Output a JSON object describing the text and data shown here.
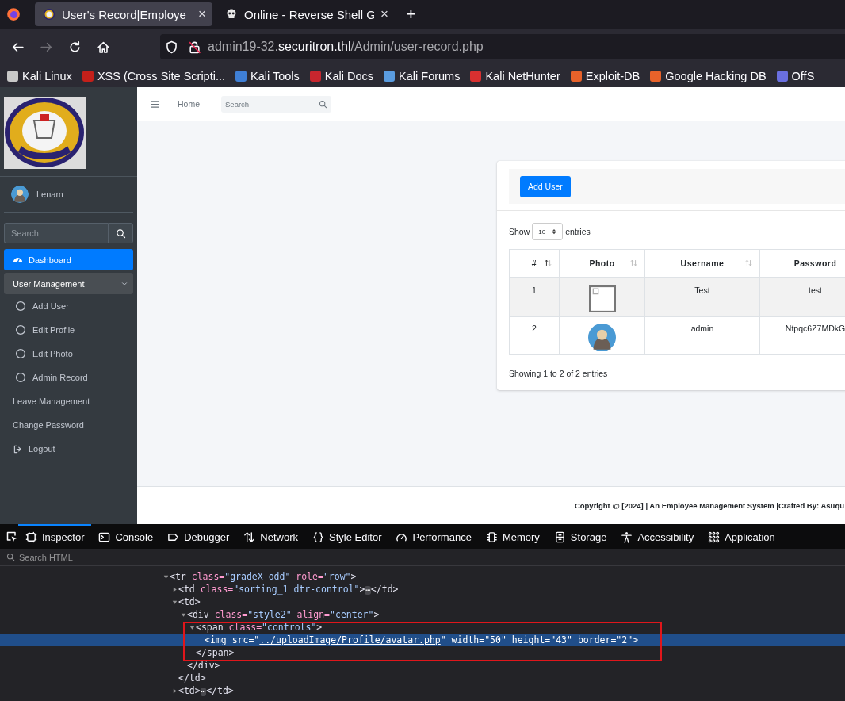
{
  "browser": {
    "tabs": [
      {
        "title": "User's Record|Employe",
        "kind": "emblem",
        "close": "×",
        "selected": true
      },
      {
        "title": "Online - Reverse Shell G",
        "kind": "skull",
        "close": "×",
        "selected": false
      }
    ],
    "new_tab": "+",
    "nav_buttons": [
      {
        "kind": "back",
        "disabled": false
      },
      {
        "kind": "forward",
        "disabled": true
      },
      {
        "kind": "reload",
        "disabled": false
      },
      {
        "kind": "home",
        "disabled": false
      }
    ],
    "address": {
      "host_prefix": "admin19-32.",
      "domain": "securitron.thl",
      "path": "/Admin/user-record.php"
    },
    "bookmarks": [
      {
        "label": "Kali Linux",
        "color": "#c8c8c8"
      },
      {
        "label": "XSS (Cross Site Scripti...",
        "color": "#c4201a"
      },
      {
        "label": "Kali Tools",
        "color": "#3f7fd6"
      },
      {
        "label": "Kali Docs",
        "color": "#c8262e"
      },
      {
        "label": "Kali Forums",
        "color": "#5a9ce0"
      },
      {
        "label": "Kali NetHunter",
        "color": "#d93030"
      },
      {
        "label": "Exploit-DB",
        "color": "#e8622a"
      },
      {
        "label": "Google Hacking DB",
        "color": "#e8622a"
      },
      {
        "label": "OffS",
        "color": "#6a6fe0"
      }
    ]
  },
  "sidebar": {
    "user": {
      "name": "Lenam"
    },
    "search": {
      "placeholder": "Search"
    },
    "menu": [
      {
        "label": "Dashboard",
        "kind": "gauge",
        "selected": true
      },
      {
        "label": "User Management",
        "kind": "group",
        "selected": false,
        "expanded": true,
        "children": [
          {
            "label": "Add User",
            "kind": "circle",
            "selected": false
          },
          {
            "label": "Edit Profile",
            "kind": "circle",
            "selected": false
          },
          {
            "label": "Edit Photo",
            "kind": "circle",
            "selected": false
          },
          {
            "label": "Admin Record",
            "kind": "circle",
            "selected": false
          }
        ]
      },
      {
        "label": "Leave Management",
        "kind": "plain",
        "selected": false
      },
      {
        "label": "Change Password",
        "kind": "plain",
        "selected": false
      },
      {
        "label": "Logout",
        "kind": "signout",
        "selected": false
      }
    ]
  },
  "top_nav": {
    "home_link": "Home",
    "search": {
      "placeholder": "Search"
    }
  },
  "card": {
    "add_button": "Add User",
    "length": {
      "before": "Show",
      "value": "10",
      "after": "entries"
    },
    "table": {
      "columns": [
        {
          "label": "#",
          "kind": "ascending"
        },
        {
          "label": "Photo",
          "kind": "sortable"
        },
        {
          "label": "Username",
          "kind": "sortable"
        },
        {
          "label": "Password",
          "kind": "plain"
        }
      ],
      "rows": [
        {
          "number": "1",
          "kind": "broken",
          "username": "Test",
          "password": "test"
        },
        {
          "number": "2",
          "kind": "avatar",
          "username": "admin",
          "password": "Ntpqc6Z7MDkG"
        }
      ]
    },
    "info": "Showing 1 to 2 of 2 entries"
  },
  "footer": {
    "text": "Copyright @ [2024] | An Employee Management System |Crafted By: Asuqu"
  },
  "devtools": {
    "tools": [
      {
        "label": "Inspector",
        "kind": "inspector",
        "selected": true
      },
      {
        "label": "Console",
        "kind": "console",
        "selected": false
      },
      {
        "label": "Debugger",
        "kind": "debugger",
        "selected": false
      },
      {
        "label": "Network",
        "kind": "network",
        "selected": false
      },
      {
        "label": "Style Editor",
        "kind": "style",
        "selected": false
      },
      {
        "label": "Performance",
        "kind": "performance",
        "selected": false
      },
      {
        "label": "Memory",
        "kind": "memory",
        "selected": false
      },
      {
        "label": "Storage",
        "kind": "storage",
        "selected": false
      },
      {
        "label": "Accessibility",
        "kind": "accessibility",
        "selected": false
      },
      {
        "label": "Application",
        "kind": "application",
        "selected": false
      }
    ],
    "search": {
      "placeholder": "Search HTML"
    },
    "tree": [
      {
        "expanded": true,
        "selected": false,
        "tokens": [
          {
            "kind": "tag",
            "text": "<tr"
          },
          {
            "kind": "attr",
            "text": " class="
          },
          {
            "kind": "value",
            "text": "\"gradeX odd\""
          },
          {
            "kind": "attr",
            "text": " role="
          },
          {
            "kind": "value",
            "text": "\"row\""
          },
          {
            "kind": "tag",
            "text": ">"
          }
        ],
        "children": [
          {
            "expanded": false,
            "selected": false,
            "tokens": [
              {
                "kind": "tag",
                "text": "<td"
              },
              {
                "kind": "attr",
                "text": " class="
              },
              {
                "kind": "value",
                "text": "\"sorting_1 dtr-control\""
              },
              {
                "kind": "tag",
                "text": ">"
              },
              {
                "kind": "badge",
                "text": "⋯"
              },
              {
                "kind": "tag",
                "text": "</td>"
              }
            ]
          },
          {
            "expanded": true,
            "selected": false,
            "tokens": [
              {
                "kind": "tag",
                "text": "<td>"
              }
            ],
            "close": "</td>",
            "children": [
              {
                "expanded": true,
                "selected": false,
                "tokens": [
                  {
                    "kind": "tag",
                    "text": "<div"
                  },
                  {
                    "kind": "attr",
                    "text": " class="
                  },
                  {
                    "kind": "value",
                    "text": "\"style2\""
                  },
                  {
                    "kind": "attr",
                    "text": " align="
                  },
                  {
                    "kind": "value",
                    "text": "\"center\""
                  },
                  {
                    "kind": "tag",
                    "text": ">"
                  }
                ],
                "close": "</div>",
                "children": [
                  {
                    "expanded": true,
                    "selected": false,
                    "boxed": true,
                    "tokens": [
                      {
                        "kind": "tag",
                        "text": "<span"
                      },
                      {
                        "kind": "attr",
                        "text": " class="
                      },
                      {
                        "kind": "value",
                        "text": "\"controls\""
                      },
                      {
                        "kind": "tag",
                        "text": ">"
                      }
                    ],
                    "close": "</span>",
                    "children": [
                      {
                        "selected": true,
                        "tokens": [
                          {
                            "kind": "tag",
                            "text": "<img"
                          },
                          {
                            "kind": "attr",
                            "text": " src="
                          },
                          {
                            "kind": "value",
                            "text": "\""
                          },
                          {
                            "kind": "link",
                            "text": "../uploadImage/Profile/avatar.php"
                          },
                          {
                            "kind": "value",
                            "text": "\""
                          },
                          {
                            "kind": "attr",
                            "text": " width="
                          },
                          {
                            "kind": "value",
                            "text": "\"50\""
                          },
                          {
                            "kind": "attr",
                            "text": " height="
                          },
                          {
                            "kind": "value",
                            "text": "\"43\""
                          },
                          {
                            "kind": "attr",
                            "text": " border="
                          },
                          {
                            "kind": "value",
                            "text": "\"2\""
                          },
                          {
                            "kind": "tag",
                            "text": ">"
                          }
                        ]
                      }
                    ]
                  }
                ]
              }
            ]
          },
          {
            "expanded": false,
            "selected": false,
            "tokens": [
              {
                "kind": "tag",
                "text": "<td>"
              },
              {
                "kind": "badge",
                "text": "⋯"
              },
              {
                "kind": "tag",
                "text": "</td>"
              }
            ]
          }
        ]
      }
    ]
  }
}
